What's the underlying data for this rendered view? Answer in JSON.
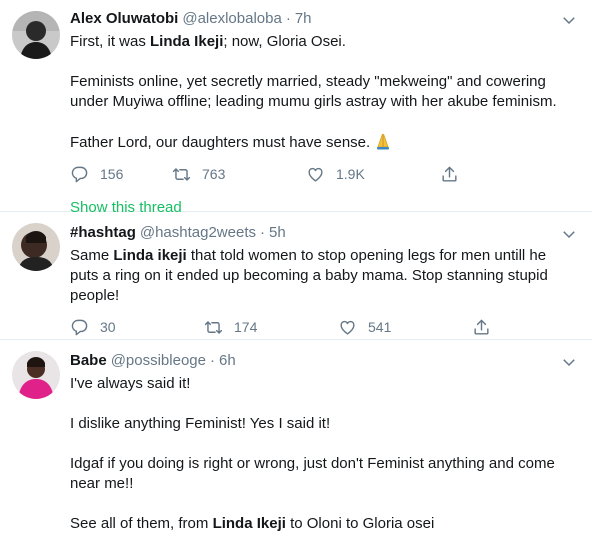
{
  "tweets": [
    {
      "display_name": "Alex Oluwatobi",
      "handle": "@alexlobaloba",
      "separator": "·",
      "time": "7h",
      "line1_prefix": "First, it was ",
      "line1_bold": "Linda Ikeji",
      "line1_suffix": "; now, Gloria Osei.",
      "line2": "Feminists online, yet secretly married, steady \"mekweing\" and cowering",
      "line3": "under Muyiwa offline; leading mumu girls astray with her akube feminism.",
      "line4": "Father Lord, our daughters must have sense.",
      "emoji": "folded-hands-emoji",
      "replies": "156",
      "retweets": "763",
      "likes": "1.9K",
      "show_thread": "Show this thread"
    },
    {
      "display_name": "#hashtag",
      "handle": "@hashtag2weets",
      "separator": "·",
      "time": "5h",
      "line1_prefix": "Same ",
      "line1_bold": "Linda ikeji",
      "line1_suffix": " that told women to stop opening legs for men untill he",
      "line2": "puts a ring on it ended up becoming a baby mama. Stop stanning stupid",
      "line3": "people!",
      "replies": "30",
      "retweets": "174",
      "likes": "541"
    },
    {
      "display_name": "Babe",
      "handle": "@possibleoge",
      "separator": "·",
      "time": "6h",
      "line1": "I've always said it!",
      "line2": "I dislike anything Feminist! Yes I said it!",
      "line3": "Idgaf if you doing is right or wrong,  just don't Feminist anything and come",
      "line4": "near me!!",
      "line5_prefix": "See all of them, from ",
      "line5_bold": "Linda Ikeji",
      "line5_suffix": " to Oloni to Gloria osei"
    }
  ],
  "colors": {
    "text": "#14171a",
    "secondary": "#657786",
    "thread_link": "#17bf63",
    "divider": "#e6ecf0"
  },
  "icons": [
    "reply-icon",
    "retweet-icon",
    "like-icon",
    "share-icon",
    "chevron-down-icon"
  ]
}
